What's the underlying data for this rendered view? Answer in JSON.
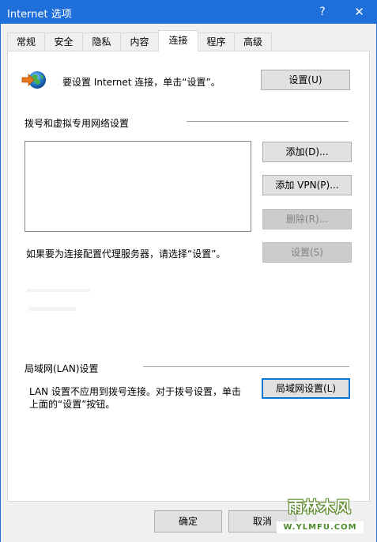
{
  "window": {
    "title": "Internet 选项",
    "help_label": "?",
    "close_label": "✕"
  },
  "tabs": [
    {
      "label": "常规",
      "active": false
    },
    {
      "label": "安全",
      "active": false
    },
    {
      "label": "隐私",
      "active": false
    },
    {
      "label": "内容",
      "active": false
    },
    {
      "label": "连接",
      "active": true
    },
    {
      "label": "程序",
      "active": false
    },
    {
      "label": "高级",
      "active": false
    }
  ],
  "connections": {
    "setup_text": "要设置 Internet 连接，单击“设置”。",
    "setup_button": "设置(U)",
    "dialup_group_title": "拨号和虚拟专用网络设置",
    "add_button": "添加(D)...",
    "add_vpn_button": "添加 VPN(P)...",
    "remove_button": "删除(R)...",
    "proxy_text": "如果要为连接配置代理服务器，请选择“设置”。",
    "settings_button": "设置(S)",
    "lan_group_title": "局域网(LAN)设置",
    "lan_text_line1": "LAN 设置不应用到拨号连接。对于拨号设置，单击",
    "lan_text_line2": "上面的“设置”按钮。",
    "lan_settings_button": "局域网设置(L)"
  },
  "footer": {
    "ok_button": "确定",
    "cancel_button": "取消"
  },
  "watermark": {
    "brand": "雨林木风",
    "url": "W.YLMFU.COM"
  },
  "icons": {
    "globe": "internet-globe-icon"
  }
}
